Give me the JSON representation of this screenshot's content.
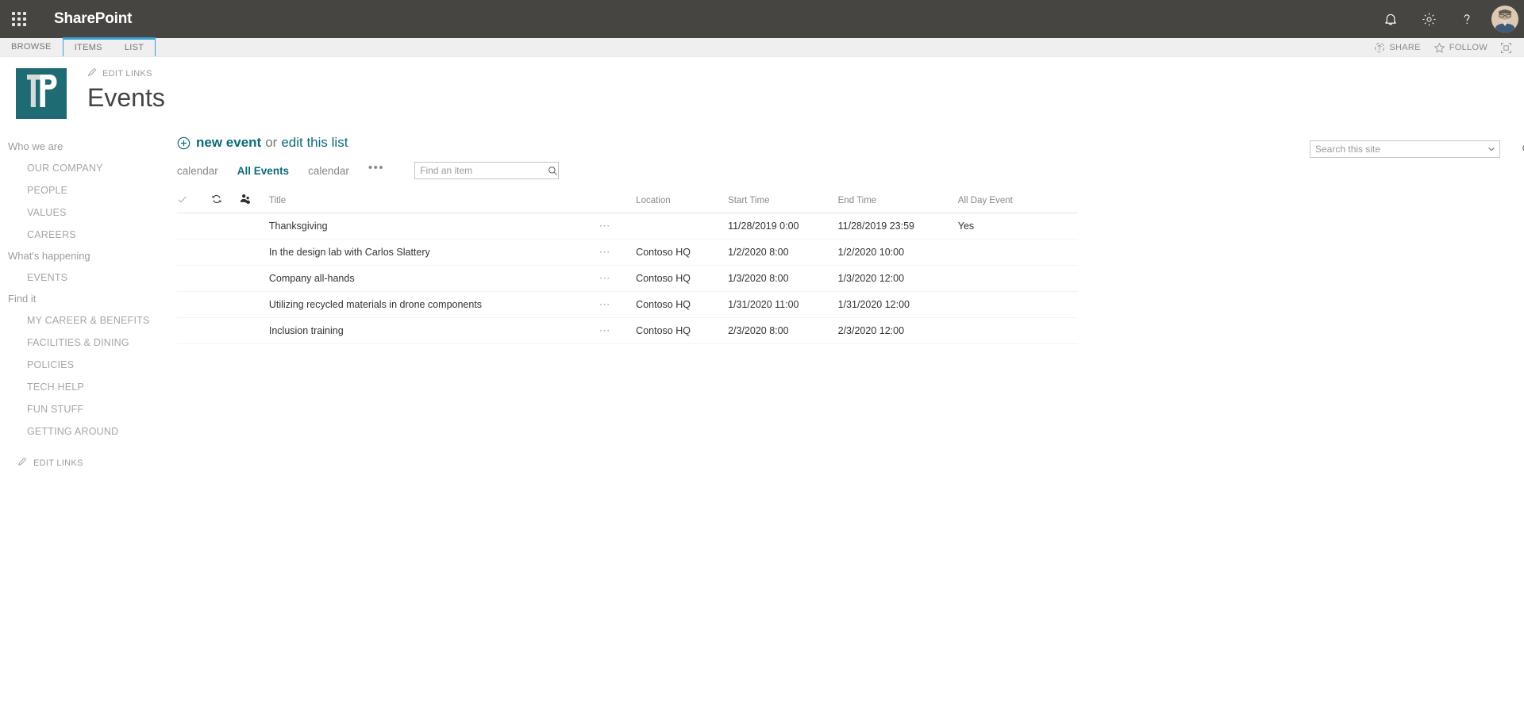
{
  "suite": {
    "brand": "SharePoint",
    "waffle_icon": "app-launcher-icon",
    "icons": [
      {
        "name": "notifications-bell-icon",
        "label": "Notifications"
      },
      {
        "name": "settings-gear-icon",
        "label": "Settings"
      },
      {
        "name": "help-question-icon",
        "label": "Help"
      }
    ],
    "avatar_name": "user-avatar"
  },
  "ribbon": {
    "browse_tab": "BROWSE",
    "tabs": [
      "ITEMS",
      "LIST"
    ],
    "actions": [
      {
        "label": "SHARE",
        "icon": "share-icon"
      },
      {
        "label": "FOLLOW",
        "icon": "star-follow-icon"
      }
    ],
    "focus_icon": "focus-on-content-icon"
  },
  "header": {
    "edit_links": "EDIT LINKS",
    "title": "Events",
    "logo_alt": "site-logo",
    "logo_color": "#1e6b73"
  },
  "search": {
    "placeholder": "Search this site",
    "value": "",
    "dropdown_icon": "chevron-down-icon",
    "search_icon": "search-icon"
  },
  "sidebar": {
    "groups": [
      {
        "heading": "Who we are",
        "links": [
          "OUR COMPANY",
          "PEOPLE",
          "VALUES",
          "CAREERS"
        ]
      },
      {
        "heading": "What's happening",
        "links": [
          "EVENTS"
        ]
      },
      {
        "heading": "Find it",
        "links": [
          "MY CAREER & BENEFITS",
          "FACILITIES & DINING",
          "POLICIES",
          "TECH HELP",
          "FUN STUFF",
          "GETTING AROUND"
        ]
      }
    ],
    "edit_links": "EDIT LINKS"
  },
  "commands": {
    "new_item": "new event",
    "or": "or",
    "edit_list": "edit this list",
    "plus_icon": "plus-circle-icon"
  },
  "views": {
    "tabs": [
      {
        "label": "calendar",
        "selected": false
      },
      {
        "label": "All Events",
        "selected": true
      },
      {
        "label": "calendar",
        "selected": false
      }
    ],
    "more": "•••",
    "find_placeholder": "Find an item",
    "find_value": "",
    "find_icon": "search-icon"
  },
  "list": {
    "header_icons": [
      {
        "name": "select-all-check-icon"
      },
      {
        "name": "sync-refresh-icon"
      },
      {
        "name": "shared-with-people-icon"
      }
    ],
    "columns": [
      "Title",
      "Location",
      "Start Time",
      "End Time",
      "All Day Event"
    ],
    "row_menu_icon": "ellipsis-menu-icon",
    "rows": [
      {
        "title": "Thanksgiving",
        "location": "",
        "start": "11/28/2019 0:00",
        "end": "11/28/2019 23:59",
        "all_day": "Yes"
      },
      {
        "title": "In the design lab with Carlos Slattery",
        "location": "Contoso HQ",
        "start": "1/2/2020 8:00",
        "end": "1/2/2020 10:00",
        "all_day": ""
      },
      {
        "title": "Company all-hands",
        "location": "Contoso HQ",
        "start": "1/3/2020 8:00",
        "end": "1/3/2020 12:00",
        "all_day": ""
      },
      {
        "title": "Utilizing recycled materials in drone components",
        "location": "Contoso HQ",
        "start": "1/31/2020 11:00",
        "end": "1/31/2020 12:00",
        "all_day": ""
      },
      {
        "title": "Inclusion training",
        "location": "Contoso HQ",
        "start": "2/3/2020 8:00",
        "end": "2/3/2020 12:00",
        "all_day": ""
      }
    ]
  },
  "colors": {
    "suite_bar": "#464542",
    "accent_teal": "#0b6a79",
    "tab_blue": "#3aa0d4"
  }
}
